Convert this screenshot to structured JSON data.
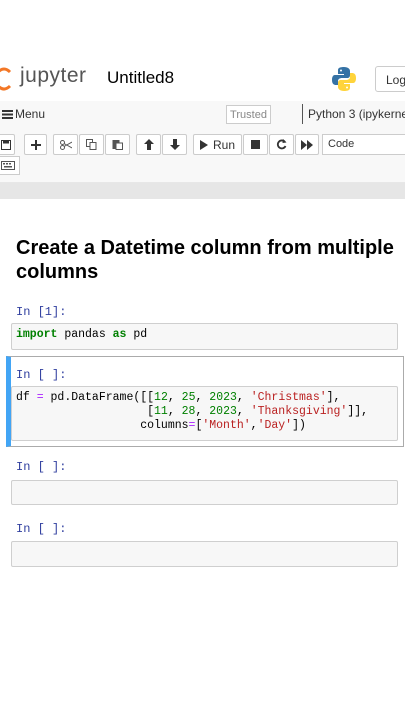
{
  "header": {
    "logo_text": "jupyter",
    "notebook_title": "Untitled8",
    "logout_label": "Logo"
  },
  "menubar": {
    "menu_label": "Menu",
    "trusted_label": "Trusted",
    "kernel_label": "Python 3 (ipykernel"
  },
  "toolbar": {
    "run_label": "Run",
    "cell_type": "Code",
    "icons": [
      "save-icon",
      "plus-icon",
      "cut-icon",
      "copy-icon",
      "paste-icon",
      "arrow-up-icon",
      "arrow-down-icon",
      "play-icon",
      "stop-icon",
      "restart-icon",
      "fast-forward-icon",
      "keyboard-icon"
    ]
  },
  "notebook": {
    "heading": "Create a Datetime column from multiple columns",
    "cells": [
      {
        "prompt": "In [1]:",
        "code_lines": [
          "import pandas as pd"
        ]
      },
      {
        "prompt": "In [ ]:",
        "code_lines": [
          "df = pd.DataFrame([[12, 25, 2023, 'Christmas'],",
          "                   [11, 28, 2023, 'Thanksgiving']],",
          "                  columns=['Month','Day'])"
        ]
      },
      {
        "prompt": "In [ ]:",
        "code_lines": [
          ""
        ]
      },
      {
        "prompt": "In [ ]:",
        "code_lines": [
          ""
        ]
      }
    ]
  },
  "colors": {
    "selected_cell_border": "#42A5F5",
    "prompt_color": "#303F9F",
    "keyword": "#008000",
    "string": "#BA2121"
  }
}
